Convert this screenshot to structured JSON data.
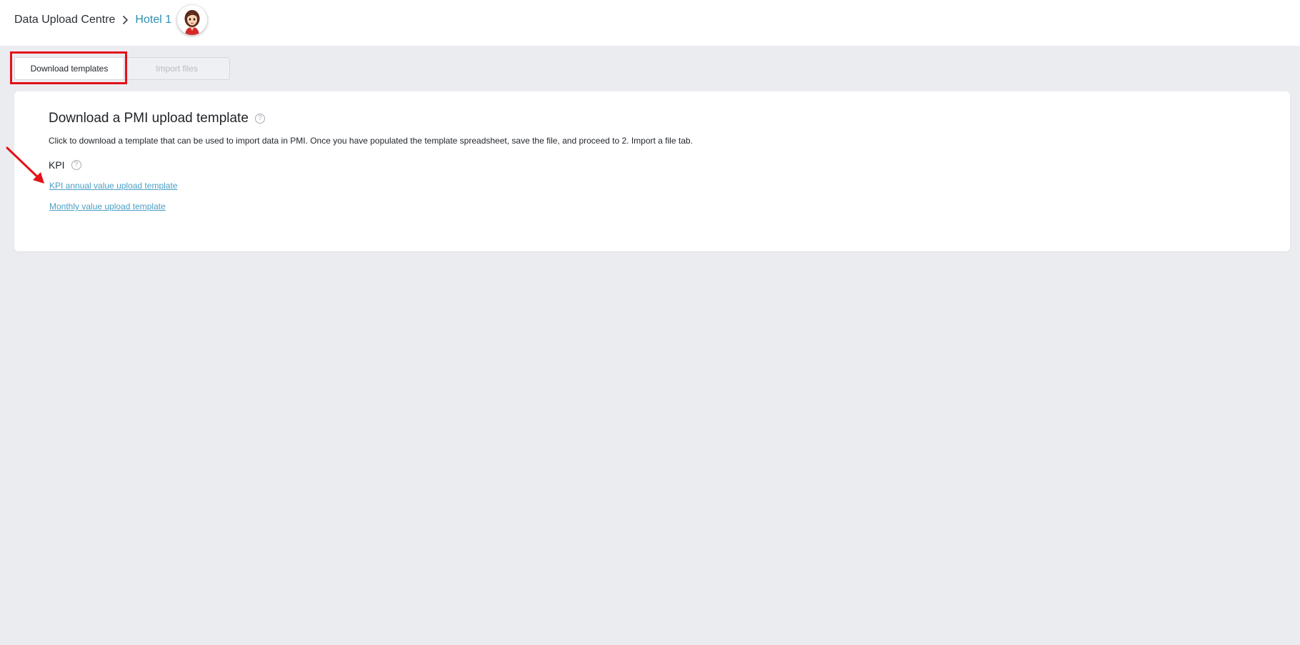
{
  "breadcrumb": {
    "root": "Data Upload Centre",
    "current": "Hotel 1"
  },
  "icons": {
    "separator": "chevron-right-icon",
    "avatar": "user-avatar",
    "help": "question-circle-icon",
    "annotation_arrow": "red-arrow-annotation"
  },
  "tabs": {
    "download_label": "Download templates",
    "import_label": "Import files"
  },
  "card": {
    "title": "Download a PMI upload template",
    "description": "Click to download a template that can be used to import data in PMI. Once you have populated the template spreadsheet, save the file, and proceed to 2. Import a file tab.",
    "help_glyph": "?",
    "section": {
      "title": "KPI",
      "links": {
        "kpi_annual": "KPI annual value upload template",
        "monthly": "Monthly value upload template"
      }
    }
  },
  "colors": {
    "background": "#ebecf0",
    "link": "#4a9ec5",
    "breadcrumb_current": "#2a8fb0",
    "annotation": "#e3121a"
  }
}
